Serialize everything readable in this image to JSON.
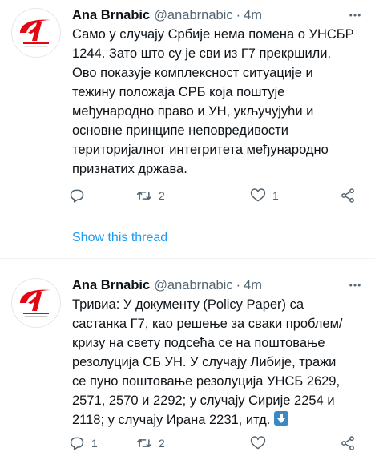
{
  "tweets": [
    {
      "author_name": "Ana Brnabic",
      "handle": "@anabrnabic",
      "separator": "·",
      "time": "4m",
      "text": "Само у случају Србије нема помена о УНСБР\n1244. Зато што су је сви из Г7 прекршили.\nОво показује комплексност ситуације и\nтежину положаја СРБ која поштује\nмеђународно право и УН, укључујући и\nосновне принципе неповредивости\nтериторијалног интегритета међународно\nпризнатих држава.",
      "reply_count": "",
      "retweet_count": "2",
      "like_count": "1",
      "show_thread": "Show this thread"
    },
    {
      "author_name": "Ana Brnabic",
      "handle": "@anabrnabic",
      "separator": "·",
      "time": "4m",
      "text": "Тривиа: У документу (Policy Paper) са\nсастанка Г7, као решење за сваки проблем/\nкризу на свету подсећа се на поштовање\nрезолуција СБ УН. У случају Либије, тражи\nсе пуно поштовање резолуција УНСБ 2629,\n2571, 2570 и 2292; у случају Сирије 2254 и\n2118; у случају Ирана 2231, итд.",
      "emoji": "down-arrow-emoji",
      "reply_count": "1",
      "retweet_count": "2",
      "like_count": ""
    }
  ],
  "icons": {
    "reply": "reply-icon",
    "retweet": "retweet-icon",
    "like": "heart-icon",
    "share": "share-icon",
    "more": "more-icon"
  },
  "colors": {
    "accent": "#1d9bf0",
    "secondary_text": "#536471",
    "avatar_red": "#e30613"
  }
}
